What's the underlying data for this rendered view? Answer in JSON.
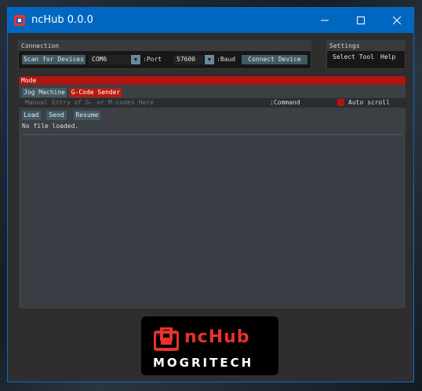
{
  "window": {
    "title": "ncHub 0.0.0"
  },
  "connection": {
    "title": "Connection",
    "scan_label": "Scan for Devices",
    "port_value": "COM6",
    "port_label": ":Port",
    "baud_value": "57600",
    "baud_label": ":Baud",
    "connect_label": "Connect Device",
    "dropdown_glyph": "▼"
  },
  "settings": {
    "title": "Settings",
    "items": [
      "Select Tool",
      "Help"
    ]
  },
  "mode": {
    "title": "Mode",
    "tabs": [
      {
        "label": "Jog Machine",
        "active": false
      },
      {
        "label": "G-Code Sender",
        "active": true
      }
    ],
    "command_placeholder": "Manual Entry of G- or M-codes Here",
    "command_label": ":Command",
    "autoscroll_label": "Auto scroll",
    "load_label": "Load",
    "send_label": "Send",
    "resume_label": "Resume",
    "file_status": "No file loaded."
  },
  "logo": {
    "product": "ncHub",
    "company": "MOGRITECH"
  },
  "colors": {
    "accent_red": "#b71a12",
    "titlebar_blue": "#0067c0",
    "button_teal": "#425a63"
  }
}
